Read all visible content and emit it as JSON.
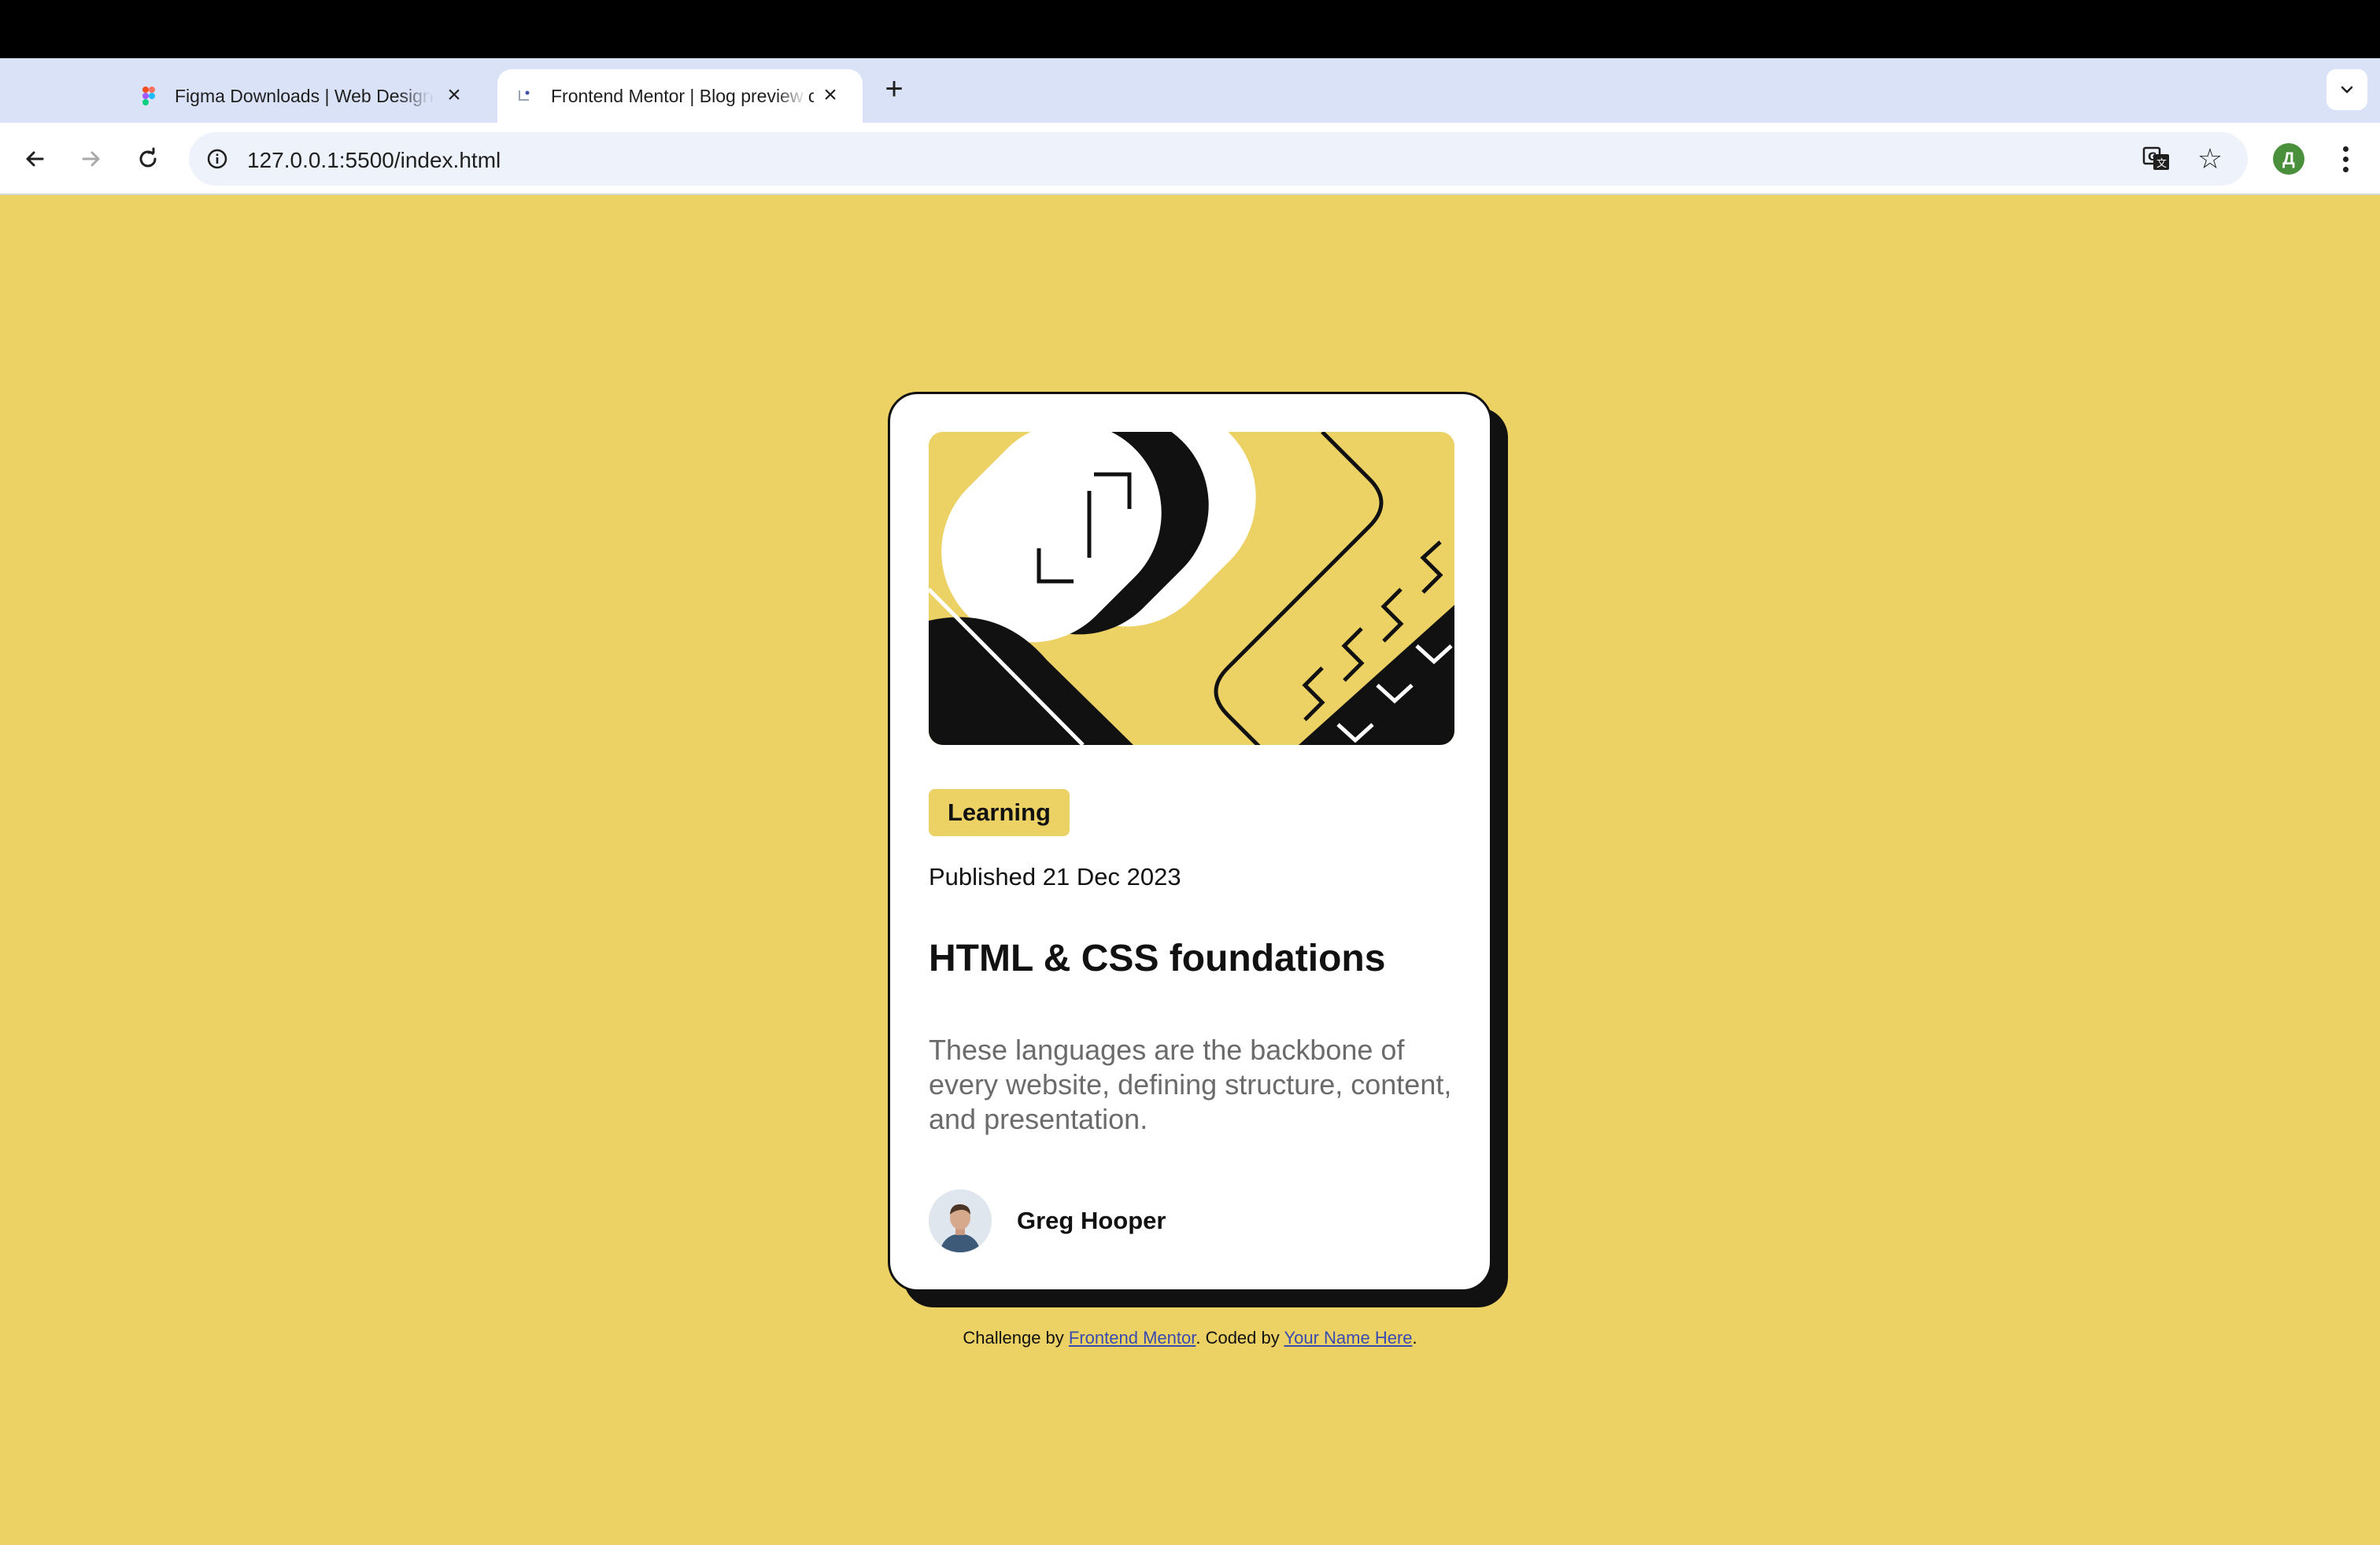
{
  "browser": {
    "tabs": [
      {
        "title": "Figma Downloads | Web Design",
        "icon": "figma-icon",
        "active": false
      },
      {
        "title": "Frontend Mentor | Blog preview card",
        "icon": "frontend-mentor-icon",
        "active": true
      }
    ],
    "address": "127.0.0.1:5500/index.html",
    "profile_initial": "Д"
  },
  "card": {
    "tag": "Learning",
    "published": "Published 21 Dec 2023",
    "title": "HTML & CSS foundations",
    "description": "These languages are the backbone of every website, defining structure, content, and presentation.",
    "author": "Greg Hooper"
  },
  "attribution": {
    "prefix": "Challenge by ",
    "link1": "Frontend Mentor",
    "middle": ". Coded by ",
    "link2": "Your Name Here",
    "suffix": "."
  },
  "colors": {
    "background": "#ecd165",
    "card": "#ffffff",
    "ink": "#111111",
    "muted_text": "#6b6b6b"
  }
}
